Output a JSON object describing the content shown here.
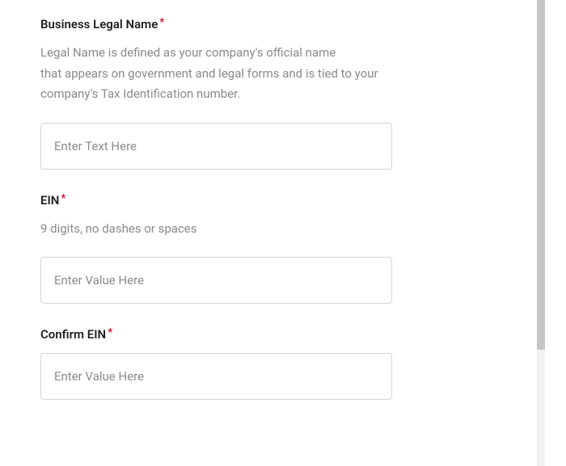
{
  "fields": {
    "businessLegalName": {
      "label": "Business Legal Name",
      "required": "*",
      "help": "Legal Name is defined as your company's official name\nthat appears on government and legal forms and is tied to your\ncompany's Tax Identification number.",
      "placeholder": "Enter Text Here"
    },
    "ein": {
      "label": "EIN",
      "required": "*",
      "help": "9 digits, no dashes or spaces",
      "placeholder": "Enter Value Here"
    },
    "confirmEin": {
      "label": "Confirm EIN",
      "required": "*",
      "placeholder": "Enter Value Here"
    }
  }
}
